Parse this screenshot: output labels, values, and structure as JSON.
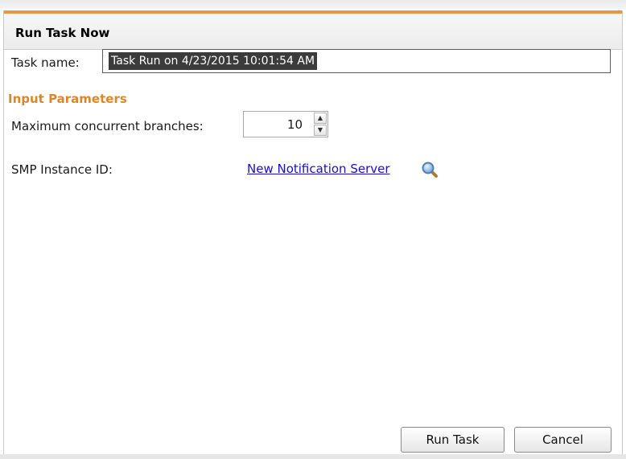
{
  "dialog": {
    "title": "Run Task Now",
    "accent_color": "#ec9440"
  },
  "task_name": {
    "label": "Task name:",
    "value": "Task Run on 4/23/2015 10:01:54 AM",
    "selected": true
  },
  "input_parameters": {
    "section_title": "Input Parameters",
    "section_color": "#d9872c",
    "max_branches": {
      "label": "Maximum concurrent branches:",
      "value": "10",
      "up_icon": "chevron-up-icon",
      "down_icon": "chevron-down-icon"
    },
    "smp_instance": {
      "label": "SMP Instance ID:",
      "value": "New Notification Server",
      "icon": "search-icon"
    }
  },
  "buttons": {
    "run": "Run Task",
    "cancel": "Cancel"
  }
}
